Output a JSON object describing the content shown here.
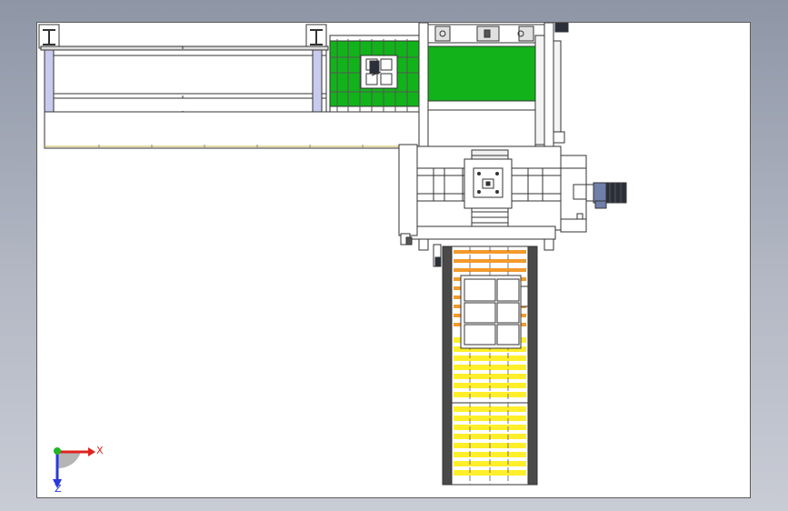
{
  "viewport": {
    "background_top": "#8e96a6",
    "background_bottom": "#c9ccd5"
  },
  "sheet": {
    "background": "#ffffff",
    "border": "#5a5a5a"
  },
  "drawing_colors": {
    "line": "#333333",
    "green_panel": "#12b31a",
    "orange_roller": "#f39a2c",
    "yellow_roller": "#ffef2a",
    "motor_dark": "#2b2f3a",
    "motor_blue": "#6f7fa8",
    "column_blue": "#c8cbee",
    "belt_frame": "#4a4a4a"
  },
  "triad": {
    "x_label": "X",
    "z_label": "Z",
    "x_color": "#e0231e",
    "y_color": "#22b524",
    "z_color": "#2a39d9",
    "icons": [
      "coordinate-triad-icon"
    ]
  }
}
